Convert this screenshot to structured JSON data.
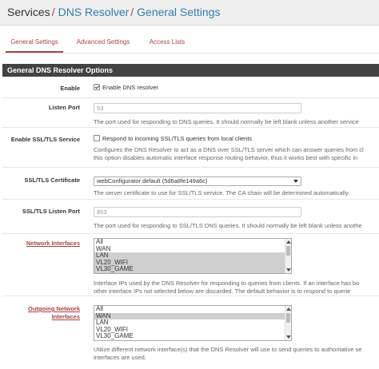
{
  "breadcrumb": {
    "root": "Services",
    "sep1": "/",
    "item1": "DNS Resolver",
    "sep2": "/",
    "item2": "General Settings"
  },
  "tabs": [
    {
      "label": "General Settings",
      "active": true
    },
    {
      "label": "Advanced Settings",
      "active": false
    },
    {
      "label": "Access Lists",
      "active": false
    }
  ],
  "panel": {
    "title": "General DNS Resolver Options"
  },
  "enable": {
    "label": "Enable",
    "checkbox_label": "Enable DNS resolver",
    "checked": true
  },
  "listen_port": {
    "label": "Listen Port",
    "placeholder": "53",
    "help": "The port used for responding to DNS queries. It should normally be left blank unless another service"
  },
  "ssl_tls": {
    "label": "Enable SSL/TLS Service",
    "checkbox_label": "Respond to incoming SSL/TLS queries from local clients",
    "checked": false,
    "help_line1": "Configures the DNS Resolver to act as a DNS over SSL/TLS server which can answer queries from cl",
    "help_line2": "this option disables automatic interface response routing behavior, thus it works best with specific in"
  },
  "ssl_cert": {
    "label": "SSL/TLS Certificate",
    "selected": "webConfigurator default (5d6a8fe149a6c)",
    "help": "The server certificate to use for SSL/TLS service. The CA chain will be determined automatically."
  },
  "ssl_port": {
    "label": "SSL/TLS Listen Port",
    "placeholder": "853",
    "help": "The port used for responding to SSL/TLS DNS queries. It should normally be left blank unless anothe"
  },
  "network_interfaces": {
    "label": "Network Interfaces",
    "options": [
      {
        "label": "All",
        "selected": false
      },
      {
        "label": "WAN",
        "selected": false
      },
      {
        "label": "LAN",
        "selected": true
      },
      {
        "label": "VL20_WIFI",
        "selected": true
      },
      {
        "label": "VL30_GAME",
        "selected": true
      }
    ],
    "help_line1": "Interface IPs used by the DNS Resolver for responding to queries from clients. If an interface has bo",
    "help_line2": "other interface IPs not selected below are discarded. The default behavior is to respond to querie"
  },
  "outgoing_interfaces": {
    "label_line1": "Outgoing Network",
    "label_line2": "Interfaces",
    "options": [
      {
        "label": "All",
        "selected": false
      },
      {
        "label": "WAN",
        "selected": true
      },
      {
        "label": "LAN",
        "selected": false
      },
      {
        "label": "VL20_WIFI",
        "selected": false
      },
      {
        "label": "VL30_GAME",
        "selected": false
      }
    ],
    "help_line1": "Utilize different network interface(s) that the DNS Resolver will use to send queries to authoritative se",
    "help_line2": "interfaces are used."
  }
}
